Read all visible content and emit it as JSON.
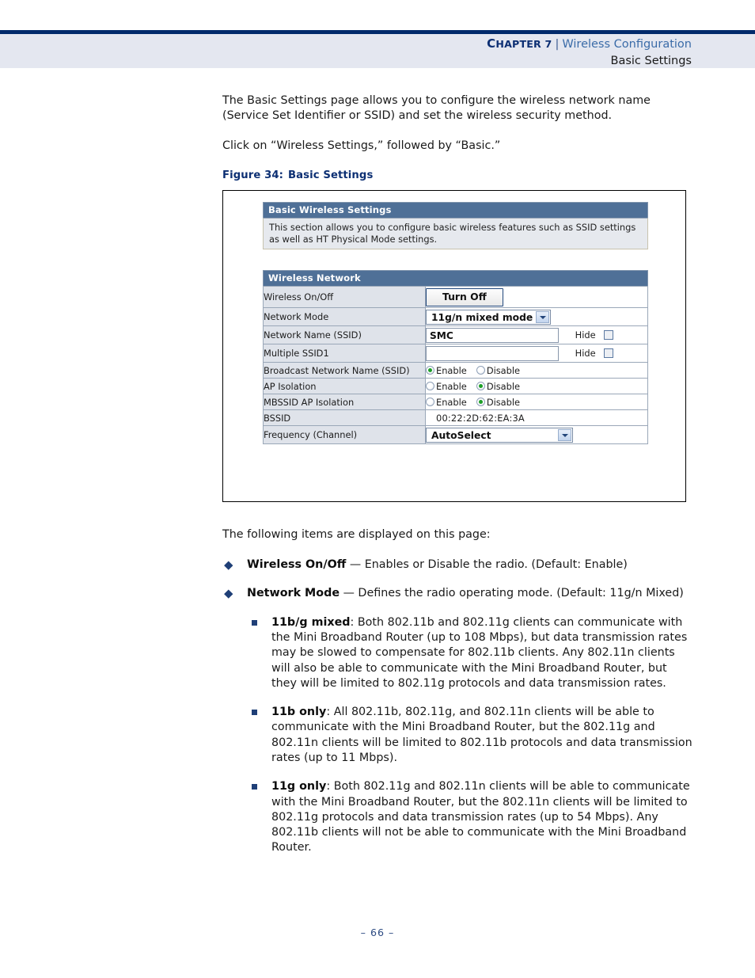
{
  "header": {
    "chapter_label": "Chapter 7",
    "chapter_label_cap": "C",
    "chapter_label_rest": "HAPTER 7",
    "separator": "|",
    "chapter_title": "Wireless Configuration",
    "section_title": "Basic Settings"
  },
  "body": {
    "intro_paragraph": "The Basic Settings page allows you to configure the wireless network name (Service Set Identifier or SSID) and set the wireless security method.",
    "click_paragraph": "Click on “Wireless Settings,” followed by “Basic.”",
    "figure_caption_number": "Figure 34:",
    "figure_caption_title": "Basic Settings",
    "following_items": "The following items are displayed on this page:"
  },
  "figure": {
    "basic_panel": {
      "heading": "Basic Wireless Settings",
      "description": "This section allows you to configure basic wireless features such as SSID settings as well as HT Physical Mode settings."
    },
    "network_panel": {
      "heading": "Wireless Network",
      "rows": [
        {
          "label": "Wireless On/Off",
          "type": "button",
          "value": "Turn Off"
        },
        {
          "label": "Network Mode",
          "type": "select",
          "value": "11g/n mixed mode"
        },
        {
          "label": "Network Name (SSID)",
          "type": "text-hide",
          "value": "SMC",
          "hide_label": "Hide",
          "hide_checked": false
        },
        {
          "label": "Multiple SSID1",
          "type": "text-hide",
          "value": "",
          "hide_label": "Hide",
          "hide_checked": false
        },
        {
          "label": "Broadcast Network Name (SSID)",
          "type": "radio",
          "options": [
            "Enable",
            "Disable"
          ],
          "selected": "Enable"
        },
        {
          "label": "AP Isolation",
          "type": "radio",
          "options": [
            "Enable",
            "Disable"
          ],
          "selected": "Disable"
        },
        {
          "label": "MBSSID AP Isolation",
          "type": "radio",
          "options": [
            "Enable",
            "Disable"
          ],
          "selected": "Disable"
        },
        {
          "label": "BSSID",
          "type": "static",
          "value": "00:22:2D:62:EA:3A"
        },
        {
          "label": "Frequency (Channel)",
          "type": "select",
          "value": "AutoSelect"
        }
      ]
    }
  },
  "bullets": {
    "items": [
      {
        "term": "Wireless On/Off",
        "text": " — Enables or Disable the radio. (Default: Enable)"
      },
      {
        "term": "Network Mode",
        "text": " — Defines the radio operating mode. (Default: 11g/n Mixed)"
      }
    ],
    "subitems": [
      {
        "term": "11b/g mixed",
        "text": ": Both 802.11b and 802.11g clients can communicate with the Mini Broadband Router (up to 108 Mbps), but data transmission rates may be slowed to compensate for 802.11b clients. Any 802.11n clients will also be able to communicate with the Mini Broadband Router, but they will be limited to 802.11g protocols and data transmission rates."
      },
      {
        "term": "11b only",
        "text": ": All 802.11b, 802.11g, and 802.11n clients will be able to communicate with the Mini Broadband Router, but the 802.11g and 802.11n clients will be limited to 802.11b protocols and data transmission rates (up to 11 Mbps)."
      },
      {
        "term": "11g only",
        "text": ": Both 802.11g and 802.11n clients will be able to communicate with the Mini Broadband Router, but the 802.11n clients will be limited to 802.11g protocols and data transmission rates (up to 54 Mbps). Any 802.11b clients will not be able to communicate with the Mini Broadband Router."
      }
    ]
  },
  "footer": {
    "page_number": "–  66  –"
  },
  "colors": {
    "header_rule": "#012a6b",
    "header_band": "#e4e7f0",
    "chapter_blue": "#0c2f73",
    "chapter_title_blue": "#3b6ca8",
    "panel_head": "#4f7097",
    "label_cell": "#dfe3ea",
    "bullet_navy": "#1f3f77",
    "radio_green": "#1d9f27"
  }
}
